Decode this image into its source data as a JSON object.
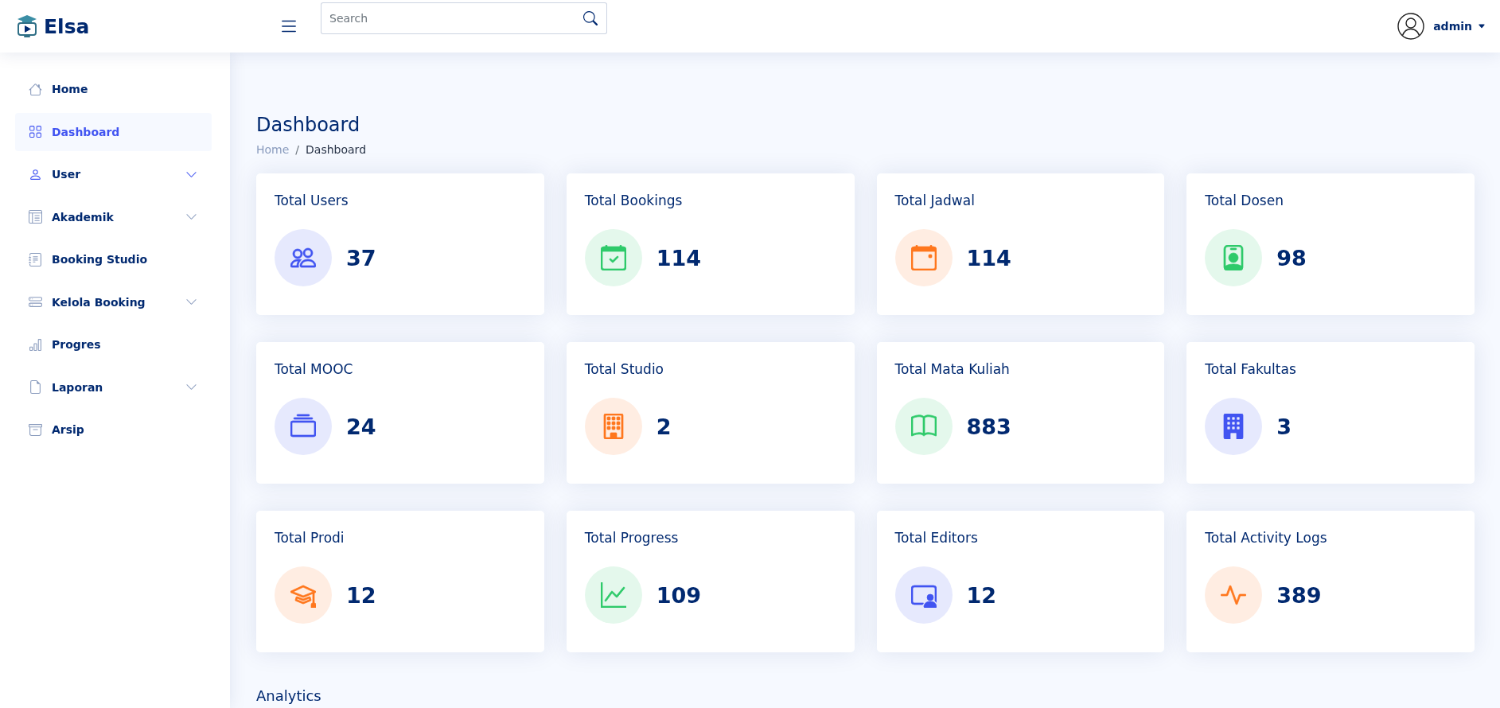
{
  "header": {
    "logo": {
      "text": "Elsa"
    },
    "search": {
      "placeholder": "Search"
    },
    "user": {
      "name": "admin"
    }
  },
  "sidebar": {
    "items": [
      {
        "label": "Home",
        "kind": "link",
        "selected": false,
        "hover": false
      },
      {
        "label": "Dashboard",
        "kind": "link",
        "selected": true,
        "hover": false
      },
      {
        "label": "User",
        "kind": "dropdown",
        "selected": false,
        "hover": true
      },
      {
        "label": "Akademik",
        "kind": "dropdown",
        "selected": false,
        "hover": false
      },
      {
        "label": "Booking Studio",
        "kind": "link",
        "selected": false,
        "hover": false
      },
      {
        "label": "Kelola Booking",
        "kind": "dropdown",
        "selected": false,
        "hover": false
      },
      {
        "label": "Progres",
        "kind": "link",
        "selected": false,
        "hover": false
      },
      {
        "label": "Laporan",
        "kind": "dropdown",
        "selected": false,
        "hover": false
      },
      {
        "label": "Arsip",
        "kind": "link",
        "selected": false,
        "hover": false
      }
    ]
  },
  "page": {
    "title": "Dashboard",
    "breadcrumb": {
      "separator": "/",
      "items": [
        {
          "label": "Home",
          "current": false
        },
        {
          "label": "Dashboard",
          "current": true
        }
      ]
    }
  },
  "stats": [
    {
      "label": "Total Users",
      "value": "37",
      "color": "#4154f1"
    },
    {
      "label": "Total Bookings",
      "value": "114",
      "color": "#2eca6a"
    },
    {
      "label": "Total Jadwal",
      "value": "114",
      "color": "#ff771d"
    },
    {
      "label": "Total Dosen",
      "value": "98",
      "color": "#2eca6a"
    },
    {
      "label": "Total MOOC",
      "value": "24",
      "color": "#4154f1"
    },
    {
      "label": "Total Studio",
      "value": "2",
      "color": "#ff771d"
    },
    {
      "label": "Total Mata Kuliah",
      "value": "883",
      "color": "#2eca6a"
    },
    {
      "label": "Total Fakultas",
      "value": "3",
      "color": "#4154f1"
    },
    {
      "label": "Total Prodi",
      "value": "12",
      "color": "#ff771d"
    },
    {
      "label": "Total Progress",
      "value": "109",
      "color": "#2eca6a"
    },
    {
      "label": "Total Editors",
      "value": "12",
      "color": "#4154f1"
    },
    {
      "label": "Total Activity Logs",
      "value": "389",
      "color": "#ff771d"
    }
  ],
  "analytics": {
    "title": "Analytics"
  }
}
